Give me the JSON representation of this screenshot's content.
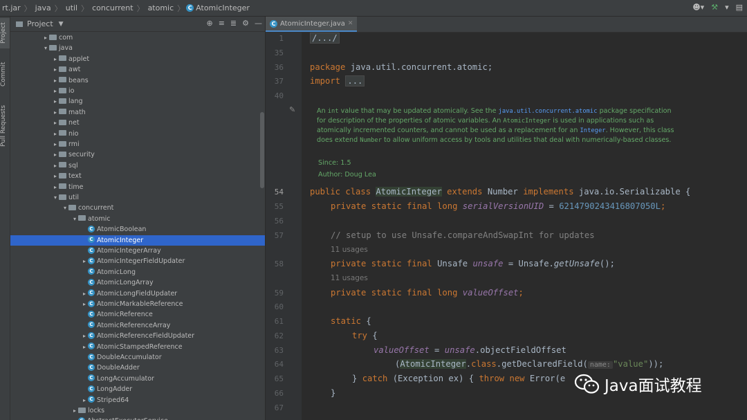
{
  "breadcrumb": [
    "rt.jar",
    "java",
    "util",
    "concurrent",
    "atomic",
    "AtomicInteger"
  ],
  "toolwindows": [
    "Project",
    "Commit",
    "Pull Requests"
  ],
  "project_panel": {
    "title": "Project"
  },
  "tree": [
    {
      "label": "com",
      "indent": 3,
      "kind": "folder",
      "arrow": "right"
    },
    {
      "label": "java",
      "indent": 3,
      "kind": "folder",
      "arrow": "down"
    },
    {
      "label": "applet",
      "indent": 4,
      "kind": "folder",
      "arrow": "right"
    },
    {
      "label": "awt",
      "indent": 4,
      "kind": "folder",
      "arrow": "right"
    },
    {
      "label": "beans",
      "indent": 4,
      "kind": "folder",
      "arrow": "right"
    },
    {
      "label": "io",
      "indent": 4,
      "kind": "folder",
      "arrow": "right"
    },
    {
      "label": "lang",
      "indent": 4,
      "kind": "folder",
      "arrow": "right"
    },
    {
      "label": "math",
      "indent": 4,
      "kind": "folder",
      "arrow": "right"
    },
    {
      "label": "net",
      "indent": 4,
      "kind": "folder",
      "arrow": "right"
    },
    {
      "label": "nio",
      "indent": 4,
      "kind": "folder",
      "arrow": "right"
    },
    {
      "label": "rmi",
      "indent": 4,
      "kind": "folder",
      "arrow": "right"
    },
    {
      "label": "security",
      "indent": 4,
      "kind": "folder",
      "arrow": "right"
    },
    {
      "label": "sql",
      "indent": 4,
      "kind": "folder",
      "arrow": "right"
    },
    {
      "label": "text",
      "indent": 4,
      "kind": "folder",
      "arrow": "right"
    },
    {
      "label": "time",
      "indent": 4,
      "kind": "folder",
      "arrow": "right"
    },
    {
      "label": "util",
      "indent": 4,
      "kind": "folder",
      "arrow": "down"
    },
    {
      "label": "concurrent",
      "indent": 5,
      "kind": "folder",
      "arrow": "down"
    },
    {
      "label": "atomic",
      "indent": 6,
      "kind": "folder",
      "arrow": "down"
    },
    {
      "label": "AtomicBoolean",
      "indent": 7,
      "kind": "class",
      "arrow": ""
    },
    {
      "label": "AtomicInteger",
      "indent": 7,
      "kind": "class",
      "arrow": "",
      "selected": true
    },
    {
      "label": "AtomicIntegerArray",
      "indent": 7,
      "kind": "class",
      "arrow": ""
    },
    {
      "label": "AtomicIntegerFieldUpdater",
      "indent": 7,
      "kind": "class",
      "arrow": "right"
    },
    {
      "label": "AtomicLong",
      "indent": 7,
      "kind": "class",
      "arrow": ""
    },
    {
      "label": "AtomicLongArray",
      "indent": 7,
      "kind": "class",
      "arrow": ""
    },
    {
      "label": "AtomicLongFieldUpdater",
      "indent": 7,
      "kind": "class",
      "arrow": "right"
    },
    {
      "label": "AtomicMarkableReference",
      "indent": 7,
      "kind": "class",
      "arrow": "right"
    },
    {
      "label": "AtomicReference",
      "indent": 7,
      "kind": "class",
      "arrow": ""
    },
    {
      "label": "AtomicReferenceArray",
      "indent": 7,
      "kind": "class",
      "arrow": ""
    },
    {
      "label": "AtomicReferenceFieldUpdater",
      "indent": 7,
      "kind": "class",
      "arrow": "right"
    },
    {
      "label": "AtomicStampedReference",
      "indent": 7,
      "kind": "class",
      "arrow": "right"
    },
    {
      "label": "DoubleAccumulator",
      "indent": 7,
      "kind": "class",
      "arrow": ""
    },
    {
      "label": "DoubleAdder",
      "indent": 7,
      "kind": "class",
      "arrow": ""
    },
    {
      "label": "LongAccumulator",
      "indent": 7,
      "kind": "class",
      "arrow": ""
    },
    {
      "label": "LongAdder",
      "indent": 7,
      "kind": "class",
      "arrow": ""
    },
    {
      "label": "Striped64",
      "indent": 7,
      "kind": "class",
      "arrow": "right"
    },
    {
      "label": "locks",
      "indent": 6,
      "kind": "folder",
      "arrow": "right"
    },
    {
      "label": "AbstractExecutorService",
      "indent": 6,
      "kind": "class",
      "arrow": ""
    }
  ],
  "editor": {
    "tab": "AtomicInteger.java",
    "line_numbers": [
      "1",
      "35",
      "36",
      "37",
      "40",
      "54",
      "55",
      "56",
      "57",
      "58",
      "59",
      "60",
      "61",
      "62",
      "63",
      "64",
      "65",
      "66",
      "67"
    ],
    "code": {
      "l1": "/.../",
      "l36_kw": "package",
      "l36_rest": " java.util.concurrent.atomic;",
      "l37_kw": "import",
      "l37_fold": "...",
      "l54_a": "public class ",
      "l54_cls": "AtomicInteger",
      "l54_b": " extends ",
      "l54_c": "Number",
      "l54_d": " implements ",
      "l54_e": "java.io.Serializable {",
      "l55_kw": "private static final long ",
      "l55_field": "serialVersionUID",
      "l55_eq": " = ",
      "l55_num": "6214790243416807050L",
      "l55_end": ";",
      "l57": "// setup to use Unsafe.compareAndSwapInt for updates",
      "l58_kw": "private static final ",
      "l58_type": "Unsafe ",
      "l58_field": "unsafe",
      "l58_eq": " = Unsafe.",
      "l58_call": "getUnsafe",
      "l58_end": "();",
      "l59_kw": "private static final long ",
      "l59_field": "valueOffset",
      "l59_end": ";",
      "l61_kw": "static",
      "l61_end": " {",
      "l62_kw": "try",
      "l62_end": " {",
      "l63_field": "valueOffset",
      "l63_eq": " = ",
      "l63_field2": "unsafe",
      "l63_end": ".objectFieldOffset",
      "l64_open": "(",
      "l64_cls": "AtomicInteger",
      "l64_dot": ".",
      "l64_kw": "class",
      "l64_call": ".getDeclaredField(",
      "l64_hint": "name:",
      "l64_str": "\"value\"",
      "l64_end": "));",
      "l65_a": "} ",
      "l65_kw": "catch",
      "l65_b": " (Exception ex) { ",
      "l65_kw2": "throw new ",
      "l65_c": "Error(e",
      "l66": "}"
    },
    "usages_58": "11 usages",
    "usages_59": "11 usages",
    "doc": {
      "p1": "An ",
      "p1_code": "int",
      "p2": " value that may be updated atomically. See the ",
      "p2_link": "java.util.concurrent.atomic",
      "p3": " package specification for description of the properties of atomic variables. An ",
      "p3_code": "AtomicInteger",
      "p4": " is used in applications such as atomically incremented counters, and cannot be used as a replacement for an ",
      "p4_link": "Integer",
      "p5": ". However, this class does extend ",
      "p5_code": "Number",
      "p6": " to allow uniform access by tools and utilities that deal with numerically-based classes.",
      "since": "Since:   1.5",
      "author": "Author: Doug Lea"
    }
  },
  "watermark": "Java面试教程"
}
